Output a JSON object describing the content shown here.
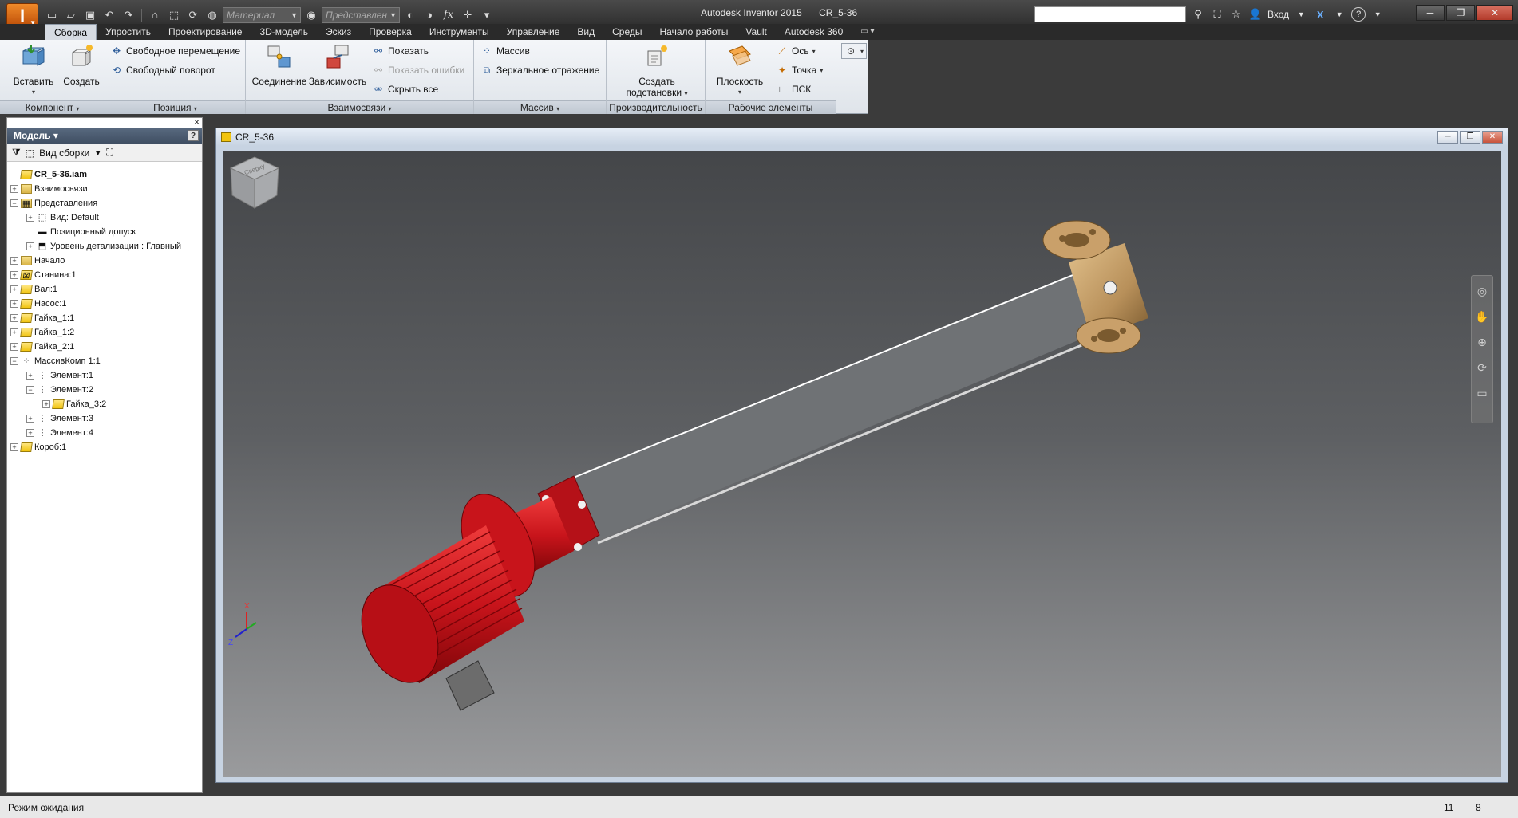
{
  "app": {
    "logo": "I",
    "title": "Autodesk Inventor 2015",
    "document": "CR_5-36"
  },
  "qat": {
    "material_placeholder": "Материал",
    "appearance_placeholder": "Представлен",
    "fx": "fx"
  },
  "help": {
    "signin": "Вход"
  },
  "tabs": [
    {
      "label": "Сборка",
      "active": true
    },
    {
      "label": "Упростить"
    },
    {
      "label": "Проектирование"
    },
    {
      "label": "3D-модель"
    },
    {
      "label": "Эскиз"
    },
    {
      "label": "Проверка"
    },
    {
      "label": "Инструменты"
    },
    {
      "label": "Управление"
    },
    {
      "label": "Вид"
    },
    {
      "label": "Среды"
    },
    {
      "label": "Начало работы"
    },
    {
      "label": "Vault"
    },
    {
      "label": "Autodesk 360"
    }
  ],
  "ribbon": {
    "component": {
      "label": "Компонент",
      "insert": "Вставить",
      "create": "Создать"
    },
    "position": {
      "label": "Позиция",
      "free_move": "Свободное перемещение",
      "free_rotate": "Свободный поворот"
    },
    "relationships": {
      "label": "Взаимосвязи",
      "joint": "Соединение",
      "constrain": "Зависимость",
      "show": "Показать",
      "show_sick": "Показать ошибки",
      "hide_all": "Скрыть все"
    },
    "pattern": {
      "label": "Массив",
      "pattern": "Массив",
      "mirror": "Зеркальное отражение"
    },
    "productivity": {
      "label": "Производительность",
      "substitute_line1": "Создать",
      "substitute_line2": "подстановки"
    },
    "work_features": {
      "label": "Рабочие элементы",
      "plane": "Плоскость",
      "axis": "Ось",
      "point": "Точка",
      "ucs": "ПСК"
    }
  },
  "browser": {
    "title": "Модель",
    "view_label": "Вид сборки",
    "close": "×",
    "help": "?",
    "tree": [
      {
        "label": "CR_5-36.iam",
        "level": 0,
        "exp": "",
        "icon": "asm-icon",
        "root": true
      },
      {
        "label": "Взаимосвязи",
        "level": 0,
        "exp": "+",
        "icon": "folder-icon"
      },
      {
        "label": "Представления",
        "level": 0,
        "exp": "−",
        "icon": "representations-icon"
      },
      {
        "label": "Вид: Default",
        "level": 1,
        "exp": "+",
        "icon": "view-icon"
      },
      {
        "label": "Позиционный допуск",
        "level": 1,
        "exp": "",
        "icon": "position-icon"
      },
      {
        "label": "Уровень детализации : Главный",
        "level": 1,
        "exp": "+",
        "icon": "lod-icon"
      },
      {
        "label": "Начало",
        "level": 0,
        "exp": "+",
        "icon": "folder-icon"
      },
      {
        "label": "Станина:1",
        "level": 0,
        "exp": "+",
        "icon": "frame-icon"
      },
      {
        "label": "Вал:1",
        "level": 0,
        "exp": "+",
        "icon": "part-icon"
      },
      {
        "label": "Насос:1",
        "level": 0,
        "exp": "+",
        "icon": "part-icon"
      },
      {
        "label": "Гайка_1:1",
        "level": 0,
        "exp": "+",
        "icon": "part-icon"
      },
      {
        "label": "Гайка_1:2",
        "level": 0,
        "exp": "+",
        "icon": "part-icon"
      },
      {
        "label": "Гайка_2:1",
        "level": 0,
        "exp": "+",
        "icon": "part-icon"
      },
      {
        "label": "МассивКомп 1:1",
        "level": 0,
        "exp": "−",
        "icon": "pattern-icon"
      },
      {
        "label": "Элемент:1",
        "level": 1,
        "exp": "+",
        "icon": "element-icon"
      },
      {
        "label": "Элемент:2",
        "level": 1,
        "exp": "−",
        "icon": "element-icon"
      },
      {
        "label": "Гайка_3:2",
        "level": 2,
        "exp": "+",
        "icon": "part-icon"
      },
      {
        "label": "Элемент:3",
        "level": 1,
        "exp": "+",
        "icon": "element-icon"
      },
      {
        "label": "Элемент:4",
        "level": 1,
        "exp": "+",
        "icon": "element-icon"
      },
      {
        "label": "Короб:1",
        "level": 0,
        "exp": "+",
        "icon": "part-icon"
      }
    ]
  },
  "viewport": {
    "window_title": "CR_5-36",
    "viewcube_label": "Сверху",
    "triad": {
      "x": "X",
      "z": "Z"
    },
    "colors": {
      "motor": "#c8141b",
      "tube": "#c9cbce",
      "bronze": "#b8905a"
    }
  },
  "status": {
    "text": "Режим ожидания",
    "count1": "11",
    "count2": "8"
  }
}
